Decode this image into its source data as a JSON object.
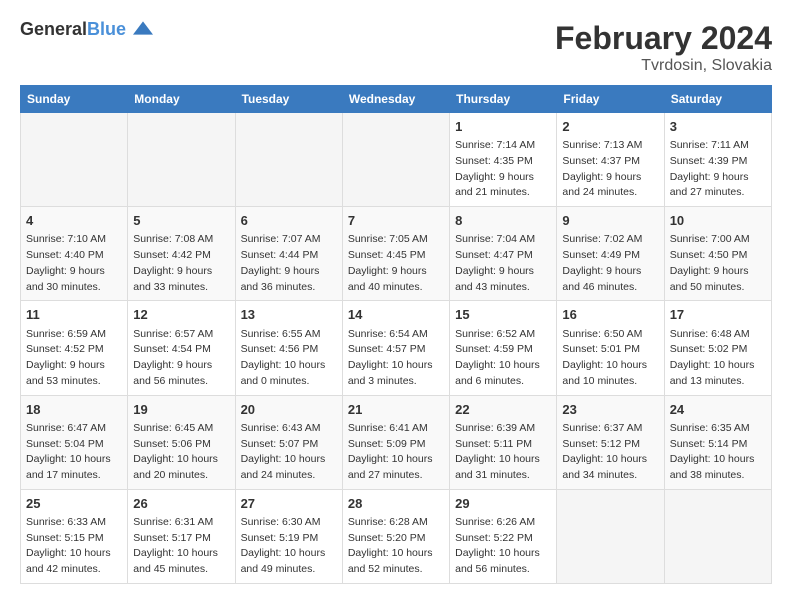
{
  "header": {
    "logo_general": "General",
    "logo_blue": "Blue",
    "month_year": "February 2024",
    "location": "Tvrdosin, Slovakia"
  },
  "calendar": {
    "days_of_week": [
      "Sunday",
      "Monday",
      "Tuesday",
      "Wednesday",
      "Thursday",
      "Friday",
      "Saturday"
    ],
    "weeks": [
      [
        {
          "day": "",
          "info": ""
        },
        {
          "day": "",
          "info": ""
        },
        {
          "day": "",
          "info": ""
        },
        {
          "day": "",
          "info": ""
        },
        {
          "day": "1",
          "info": "Sunrise: 7:14 AM\nSunset: 4:35 PM\nDaylight: 9 hours\nand 21 minutes."
        },
        {
          "day": "2",
          "info": "Sunrise: 7:13 AM\nSunset: 4:37 PM\nDaylight: 9 hours\nand 24 minutes."
        },
        {
          "day": "3",
          "info": "Sunrise: 7:11 AM\nSunset: 4:39 PM\nDaylight: 9 hours\nand 27 minutes."
        }
      ],
      [
        {
          "day": "4",
          "info": "Sunrise: 7:10 AM\nSunset: 4:40 PM\nDaylight: 9 hours\nand 30 minutes."
        },
        {
          "day": "5",
          "info": "Sunrise: 7:08 AM\nSunset: 4:42 PM\nDaylight: 9 hours\nand 33 minutes."
        },
        {
          "day": "6",
          "info": "Sunrise: 7:07 AM\nSunset: 4:44 PM\nDaylight: 9 hours\nand 36 minutes."
        },
        {
          "day": "7",
          "info": "Sunrise: 7:05 AM\nSunset: 4:45 PM\nDaylight: 9 hours\nand 40 minutes."
        },
        {
          "day": "8",
          "info": "Sunrise: 7:04 AM\nSunset: 4:47 PM\nDaylight: 9 hours\nand 43 minutes."
        },
        {
          "day": "9",
          "info": "Sunrise: 7:02 AM\nSunset: 4:49 PM\nDaylight: 9 hours\nand 46 minutes."
        },
        {
          "day": "10",
          "info": "Sunrise: 7:00 AM\nSunset: 4:50 PM\nDaylight: 9 hours\nand 50 minutes."
        }
      ],
      [
        {
          "day": "11",
          "info": "Sunrise: 6:59 AM\nSunset: 4:52 PM\nDaylight: 9 hours\nand 53 minutes."
        },
        {
          "day": "12",
          "info": "Sunrise: 6:57 AM\nSunset: 4:54 PM\nDaylight: 9 hours\nand 56 minutes."
        },
        {
          "day": "13",
          "info": "Sunrise: 6:55 AM\nSunset: 4:56 PM\nDaylight: 10 hours\nand 0 minutes."
        },
        {
          "day": "14",
          "info": "Sunrise: 6:54 AM\nSunset: 4:57 PM\nDaylight: 10 hours\nand 3 minutes."
        },
        {
          "day": "15",
          "info": "Sunrise: 6:52 AM\nSunset: 4:59 PM\nDaylight: 10 hours\nand 6 minutes."
        },
        {
          "day": "16",
          "info": "Sunrise: 6:50 AM\nSunset: 5:01 PM\nDaylight: 10 hours\nand 10 minutes."
        },
        {
          "day": "17",
          "info": "Sunrise: 6:48 AM\nSunset: 5:02 PM\nDaylight: 10 hours\nand 13 minutes."
        }
      ],
      [
        {
          "day": "18",
          "info": "Sunrise: 6:47 AM\nSunset: 5:04 PM\nDaylight: 10 hours\nand 17 minutes."
        },
        {
          "day": "19",
          "info": "Sunrise: 6:45 AM\nSunset: 5:06 PM\nDaylight: 10 hours\nand 20 minutes."
        },
        {
          "day": "20",
          "info": "Sunrise: 6:43 AM\nSunset: 5:07 PM\nDaylight: 10 hours\nand 24 minutes."
        },
        {
          "day": "21",
          "info": "Sunrise: 6:41 AM\nSunset: 5:09 PM\nDaylight: 10 hours\nand 27 minutes."
        },
        {
          "day": "22",
          "info": "Sunrise: 6:39 AM\nSunset: 5:11 PM\nDaylight: 10 hours\nand 31 minutes."
        },
        {
          "day": "23",
          "info": "Sunrise: 6:37 AM\nSunset: 5:12 PM\nDaylight: 10 hours\nand 34 minutes."
        },
        {
          "day": "24",
          "info": "Sunrise: 6:35 AM\nSunset: 5:14 PM\nDaylight: 10 hours\nand 38 minutes."
        }
      ],
      [
        {
          "day": "25",
          "info": "Sunrise: 6:33 AM\nSunset: 5:15 PM\nDaylight: 10 hours\nand 42 minutes."
        },
        {
          "day": "26",
          "info": "Sunrise: 6:31 AM\nSunset: 5:17 PM\nDaylight: 10 hours\nand 45 minutes."
        },
        {
          "day": "27",
          "info": "Sunrise: 6:30 AM\nSunset: 5:19 PM\nDaylight: 10 hours\nand 49 minutes."
        },
        {
          "day": "28",
          "info": "Sunrise: 6:28 AM\nSunset: 5:20 PM\nDaylight: 10 hours\nand 52 minutes."
        },
        {
          "day": "29",
          "info": "Sunrise: 6:26 AM\nSunset: 5:22 PM\nDaylight: 10 hours\nand 56 minutes."
        },
        {
          "day": "",
          "info": ""
        },
        {
          "day": "",
          "info": ""
        }
      ]
    ]
  }
}
